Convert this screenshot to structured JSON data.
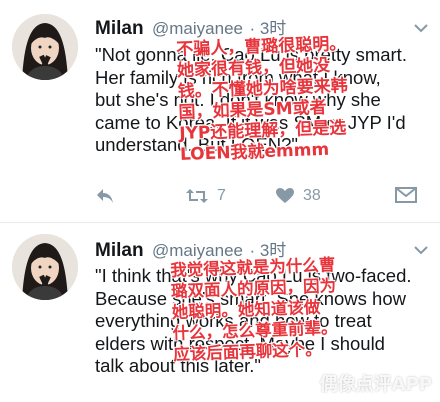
{
  "tweets": [
    {
      "name": "Milan",
      "handle": "@maiyanee",
      "time": "· 3时",
      "text": "\"Not gonna lie, Cao Lu is pretty smart.\nHer family is rich from what I know,\nbut she's not. I don't know why she\ncame to Korea. If it was SM or JYP I'd\nunderstand. But LOEN?\"",
      "overlay": "不骗人，曹璐很聪明。\n她家很有钱，但她没\n钱。不懂她为啥要来韩\n国，如果是SM或者\nJYP还能理解，但是选\nLOEN我就emmm",
      "actions": {
        "reply": "",
        "retweet": "7",
        "like": "38"
      }
    },
    {
      "name": "Milan",
      "handle": "@maiyanee",
      "time": "· 3时",
      "text": "\"I think that's why Cao Lu is two-faced.\nBecause she's smart. She knows how\neverything works and how to treat\nelders with respect. Maybe I should\ntalk about this later.\"",
      "overlay": "我觉得这就是为什么曹\n璐双面人的原因，因为\n她聪明。她知道该做\n什么，怎么尊重前辈。\n应该后面再聊这个。"
    }
  ],
  "icons": {
    "reply": "reply-icon",
    "retweet": "retweet-icon",
    "like": "heart-icon",
    "dm": "envelope-icon",
    "caret": "chevron-down-icon"
  },
  "watermark": "偶像点评APP",
  "colors": {
    "overlay_red": "#e8353c",
    "handle_gray": "#657786",
    "icon_gray": "#8899a6"
  }
}
